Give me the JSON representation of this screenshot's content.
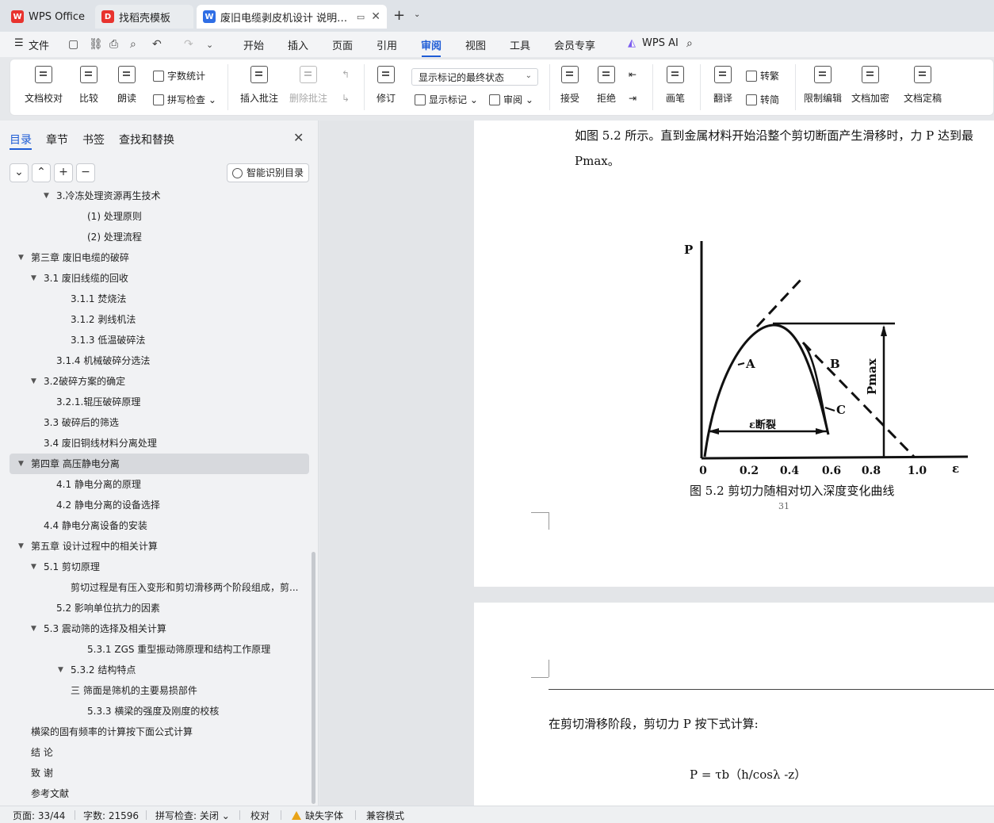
{
  "tabs": [
    {
      "label": "WPS Office",
      "icon": "wps-logo-icon"
    },
    {
      "label": "找稻壳模板",
      "icon": "docer-icon"
    },
    {
      "label": "废旧电缆剥皮机设计 说明书（",
      "icon": "writer-doc-icon",
      "active": true
    }
  ],
  "menu": {
    "file": "文件",
    "items": [
      "开始",
      "插入",
      "页面",
      "引用",
      "审阅",
      "视图",
      "工具",
      "会员专享"
    ],
    "active": "审阅",
    "wps_ai": "WPS AI"
  },
  "ribbon": {
    "proofread": "文档校对",
    "compare": "比较",
    "read_aloud": "朗读",
    "word_count": "字数统计",
    "spell_check": "拼写检查",
    "insert_comment": "插入批注",
    "delete_comment": "删除批注",
    "revise": "修订",
    "markup_state": "显示标记的最终状态",
    "show_markup": "显示标记",
    "review": "审阅",
    "accept": "接受",
    "reject": "拒绝",
    "pen": "画笔",
    "translate": "翻译",
    "to_traditional": "转繁",
    "to_simplified": "转简",
    "restrict_edit": "限制编辑",
    "encrypt": "文档加密",
    "finalize": "文档定稿"
  },
  "sidebar": {
    "tabs": [
      "目录",
      "章节",
      "书签",
      "查找和替换"
    ],
    "smart_toc": "智能识别目录",
    "toc": [
      {
        "text": "3.冷冻处理资源再生技术",
        "level": 3
      },
      {
        "text": "(1) 处理原则",
        "level": 5
      },
      {
        "text": "(2) 处理流程",
        "level": 5
      },
      {
        "text": "第三章   废旧电缆的破碎",
        "level": 1
      },
      {
        "text": "3.1 废旧线缆的回收",
        "level": 2
      },
      {
        "text": "3.1.1 焚烧法",
        "level": 4
      },
      {
        "text": "3.1.2 剥线机法",
        "level": 4
      },
      {
        "text": "3.1.3 低温破碎法",
        "level": 4
      },
      {
        "text": "3.1.4 机械破碎分选法",
        "level": 3
      },
      {
        "text": "3.2破碎方案的确定",
        "level": 2
      },
      {
        "text": "3.2.1.辊压破碎原理",
        "level": 3
      },
      {
        "text": "3.3 破碎后的筛选",
        "level": 2
      },
      {
        "text": "3.4 废旧铜线材料分离处理",
        "level": 2
      },
      {
        "text": "第四章   高压静电分离",
        "level": 1,
        "selected": true
      },
      {
        "text": "4.1 静电分离的原理",
        "level": 3
      },
      {
        "text": "4.2 静电分离的设备选择",
        "level": 3
      },
      {
        "text": "4.4 静电分离设备的安装",
        "level": 2
      },
      {
        "text": "第五章  设计过程中的相关计算",
        "level": 1
      },
      {
        "text": "5.1 剪切原理",
        "level": 2
      },
      {
        "text": "剪切过程是有压入变形和剪切滑移两个阶段组成，剪...",
        "level": 4
      },
      {
        "text": "5.2 影响单位抗力的因素",
        "level": 3
      },
      {
        "text": "5.3 震动筛的选择及相关计算",
        "level": 2
      },
      {
        "text": "5.3.1    ZGS 重型振动筛原理和结构工作原理",
        "level": 5
      },
      {
        "text": "5.3.2  结构特点",
        "level": 4
      },
      {
        "text": "三    筛面是筛机的主要易损部件",
        "level": 4
      },
      {
        "text": "5.3.3  横梁的强度及刚度的校核",
        "level": 5
      },
      {
        "text": "横梁的固有频率的计算按下面公式计算",
        "level": 1
      },
      {
        "text": "结    论",
        "level": 1
      },
      {
        "text": "致    谢",
        "level": 1
      },
      {
        "text": "参考文献",
        "level": 1
      }
    ]
  },
  "document": {
    "para1_line1": "如图 5.2 所示。直到金属材料开始沿整个剪切断面产生滑移时，力 P 达到最",
    "para1_line2": "Pmax。",
    "figure_caption": "图 5.2 剪切力随相对切入深度变化曲线",
    "page_number": "31",
    "figure": {
      "y_axis": "P",
      "x_axis": "ε",
      "x_ticks": [
        "0",
        "0.2",
        "0.4",
        "0.6",
        "0.8",
        "1.0"
      ],
      "labels": [
        "A",
        "B",
        "C"
      ],
      "pmax_label": "Pmax",
      "eps_label": "ε断裂"
    },
    "para2": "在剪切滑移阶段，剪切力 P 按下式计算:",
    "formula": "P = τb（h/cosλ -z）"
  },
  "status": {
    "page": "页面: 33/44",
    "words": "字数: 21596",
    "spell": "拼写检查: 关闭",
    "proof": "校对",
    "missing_font": "缺失字体",
    "compat": "兼容模式"
  },
  "colors": {
    "accent": "#1e5cd6",
    "wps_red": "#e8332e",
    "warning": "#e8a317"
  }
}
